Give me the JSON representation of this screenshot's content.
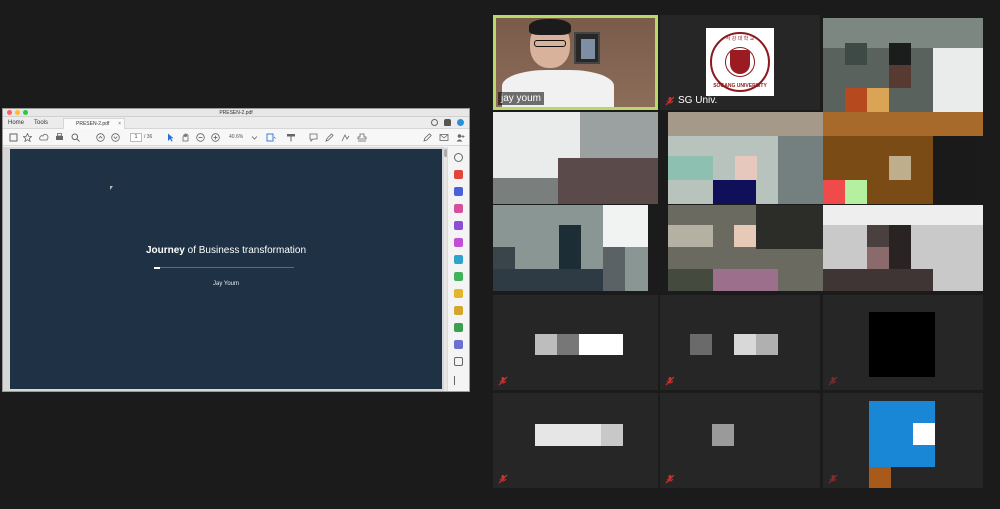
{
  "pdf_window": {
    "title": "PRESEN-2.pdf",
    "menu": {
      "home": "Home",
      "tools": "Tools"
    },
    "tab": {
      "label": "PRESEN-2.pdf",
      "close": "×"
    },
    "toolbar": {
      "page_current": "1",
      "page_total": "/ 36",
      "zoom": "40.6%"
    },
    "slide": {
      "title_bold": "Journey",
      "title_rest": " of Business transformation",
      "author": "Jay Youm"
    }
  },
  "video_grid": {
    "participants": [
      {
        "name": "jay youm",
        "active_speaker": true
      },
      {
        "name": "SG Univ.",
        "muted": true,
        "logo_top": "서 강 대 학 교",
        "logo_bottom": "SOGANG UNIVERSITY"
      },
      {
        "name": "",
        "muted": false
      },
      {
        "name": "",
        "muted": false
      },
      {
        "name": "",
        "muted": false
      },
      {
        "name": "",
        "muted": false
      },
      {
        "name": "",
        "muted": false
      },
      {
        "name": "",
        "muted": false
      },
      {
        "name": "",
        "muted": false
      },
      {
        "name": "",
        "muted": true
      },
      {
        "name": "",
        "muted": true
      },
      {
        "name": "",
        "muted": true
      },
      {
        "name": "",
        "muted": true
      },
      {
        "name": "",
        "muted": true
      },
      {
        "name": "",
        "muted": true
      }
    ]
  },
  "colors": {
    "slide_background": "#1f3144",
    "active_speaker_border": "#b8d96a",
    "mute_icon": "#d0312d",
    "app_background": "#1b1b1b"
  }
}
